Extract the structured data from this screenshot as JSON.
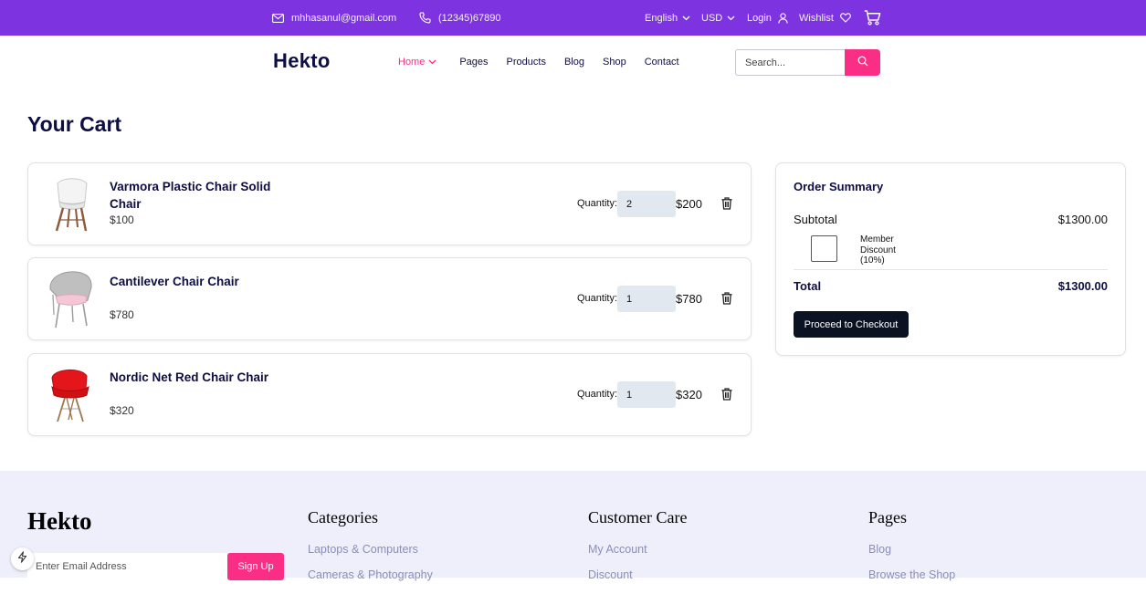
{
  "topbar": {
    "email": "mhhasanul@gmail.com",
    "phone": "(12345)67890",
    "language": "English",
    "currency": "USD",
    "login": "Login",
    "wishlist": "Wishlist"
  },
  "nav": {
    "logo": "Hekto",
    "items": [
      "Home",
      "Pages",
      "Products",
      "Blog",
      "Shop",
      "Contact"
    ],
    "search_placeholder": "Search..."
  },
  "cart": {
    "title": "Your Cart",
    "quantity_label": "Quantity:",
    "items": [
      {
        "name": "Varmora Plastic Chair Solid Chair",
        "unit_price": "$100",
        "quantity": "2",
        "line_total": "$200"
      },
      {
        "name": "Cantilever Chair Chair",
        "unit_price": "$780",
        "quantity": "1",
        "line_total": "$780"
      },
      {
        "name": "Nordic Net Red Chair Chair",
        "unit_price": "$320",
        "quantity": "1",
        "line_total": "$320"
      }
    ]
  },
  "summary": {
    "title": "Order Summary",
    "subtotal_label": "Subtotal",
    "subtotal_value": "$1300.00",
    "discount_label": "Member Discount (10%)",
    "total_label": "Total",
    "total_value": "$1300.00",
    "checkout_label": "Proceed to Checkout"
  },
  "footer": {
    "logo": "Hekto",
    "email_placeholder": "Enter Email Address",
    "signup_label": "Sign Up",
    "columns": [
      {
        "title": "Categories",
        "links": [
          "Laptops & Computers",
          "Cameras & Photography"
        ]
      },
      {
        "title": "Customer Care",
        "links": [
          "My Account",
          "Discount"
        ]
      },
      {
        "title": "Pages",
        "links": [
          "Blog",
          "Browse the Shop"
        ]
      }
    ]
  },
  "colors": {
    "topbar": "#7E33E0",
    "accent": "#FB2E86",
    "navy": "#0D0E43",
    "footer_bg": "#EEEFFB",
    "checkout_bg": "#0B1222",
    "qty_bg": "#E2E8F0"
  },
  "icons": [
    "mail-icon",
    "phone-icon",
    "chevron-down-icon",
    "user-icon",
    "heart-icon",
    "cart-icon",
    "search-icon",
    "trash-icon",
    "bolt-icon"
  ]
}
